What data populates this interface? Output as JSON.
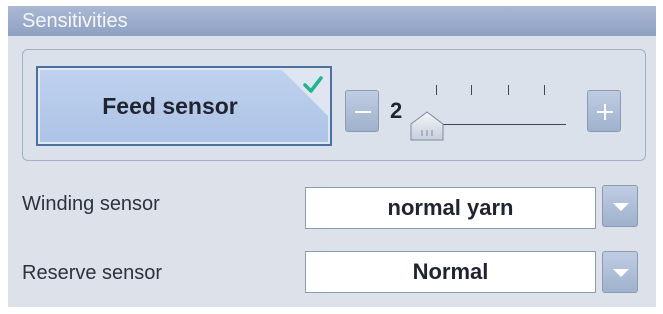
{
  "panel": {
    "title": "Sensitivities"
  },
  "feed_sensor": {
    "label": "Feed sensor",
    "checked": true,
    "check_icon": "checkmark-icon",
    "check_color": "#1fb58f",
    "slider": {
      "value": "2",
      "minus_icon": "minus-icon",
      "plus_icon": "plus-icon"
    }
  },
  "winding_sensor": {
    "label": "Winding sensor",
    "value": "normal yarn",
    "dropdown_icon": "chevron-down-icon"
  },
  "reserve_sensor": {
    "label": "Reserve sensor",
    "value": "Normal",
    "dropdown_icon": "chevron-down-icon"
  },
  "colors": {
    "accent": "#4f6f9f",
    "panel_bg": "#dde2ea",
    "titlebar": "#9aaac9"
  }
}
